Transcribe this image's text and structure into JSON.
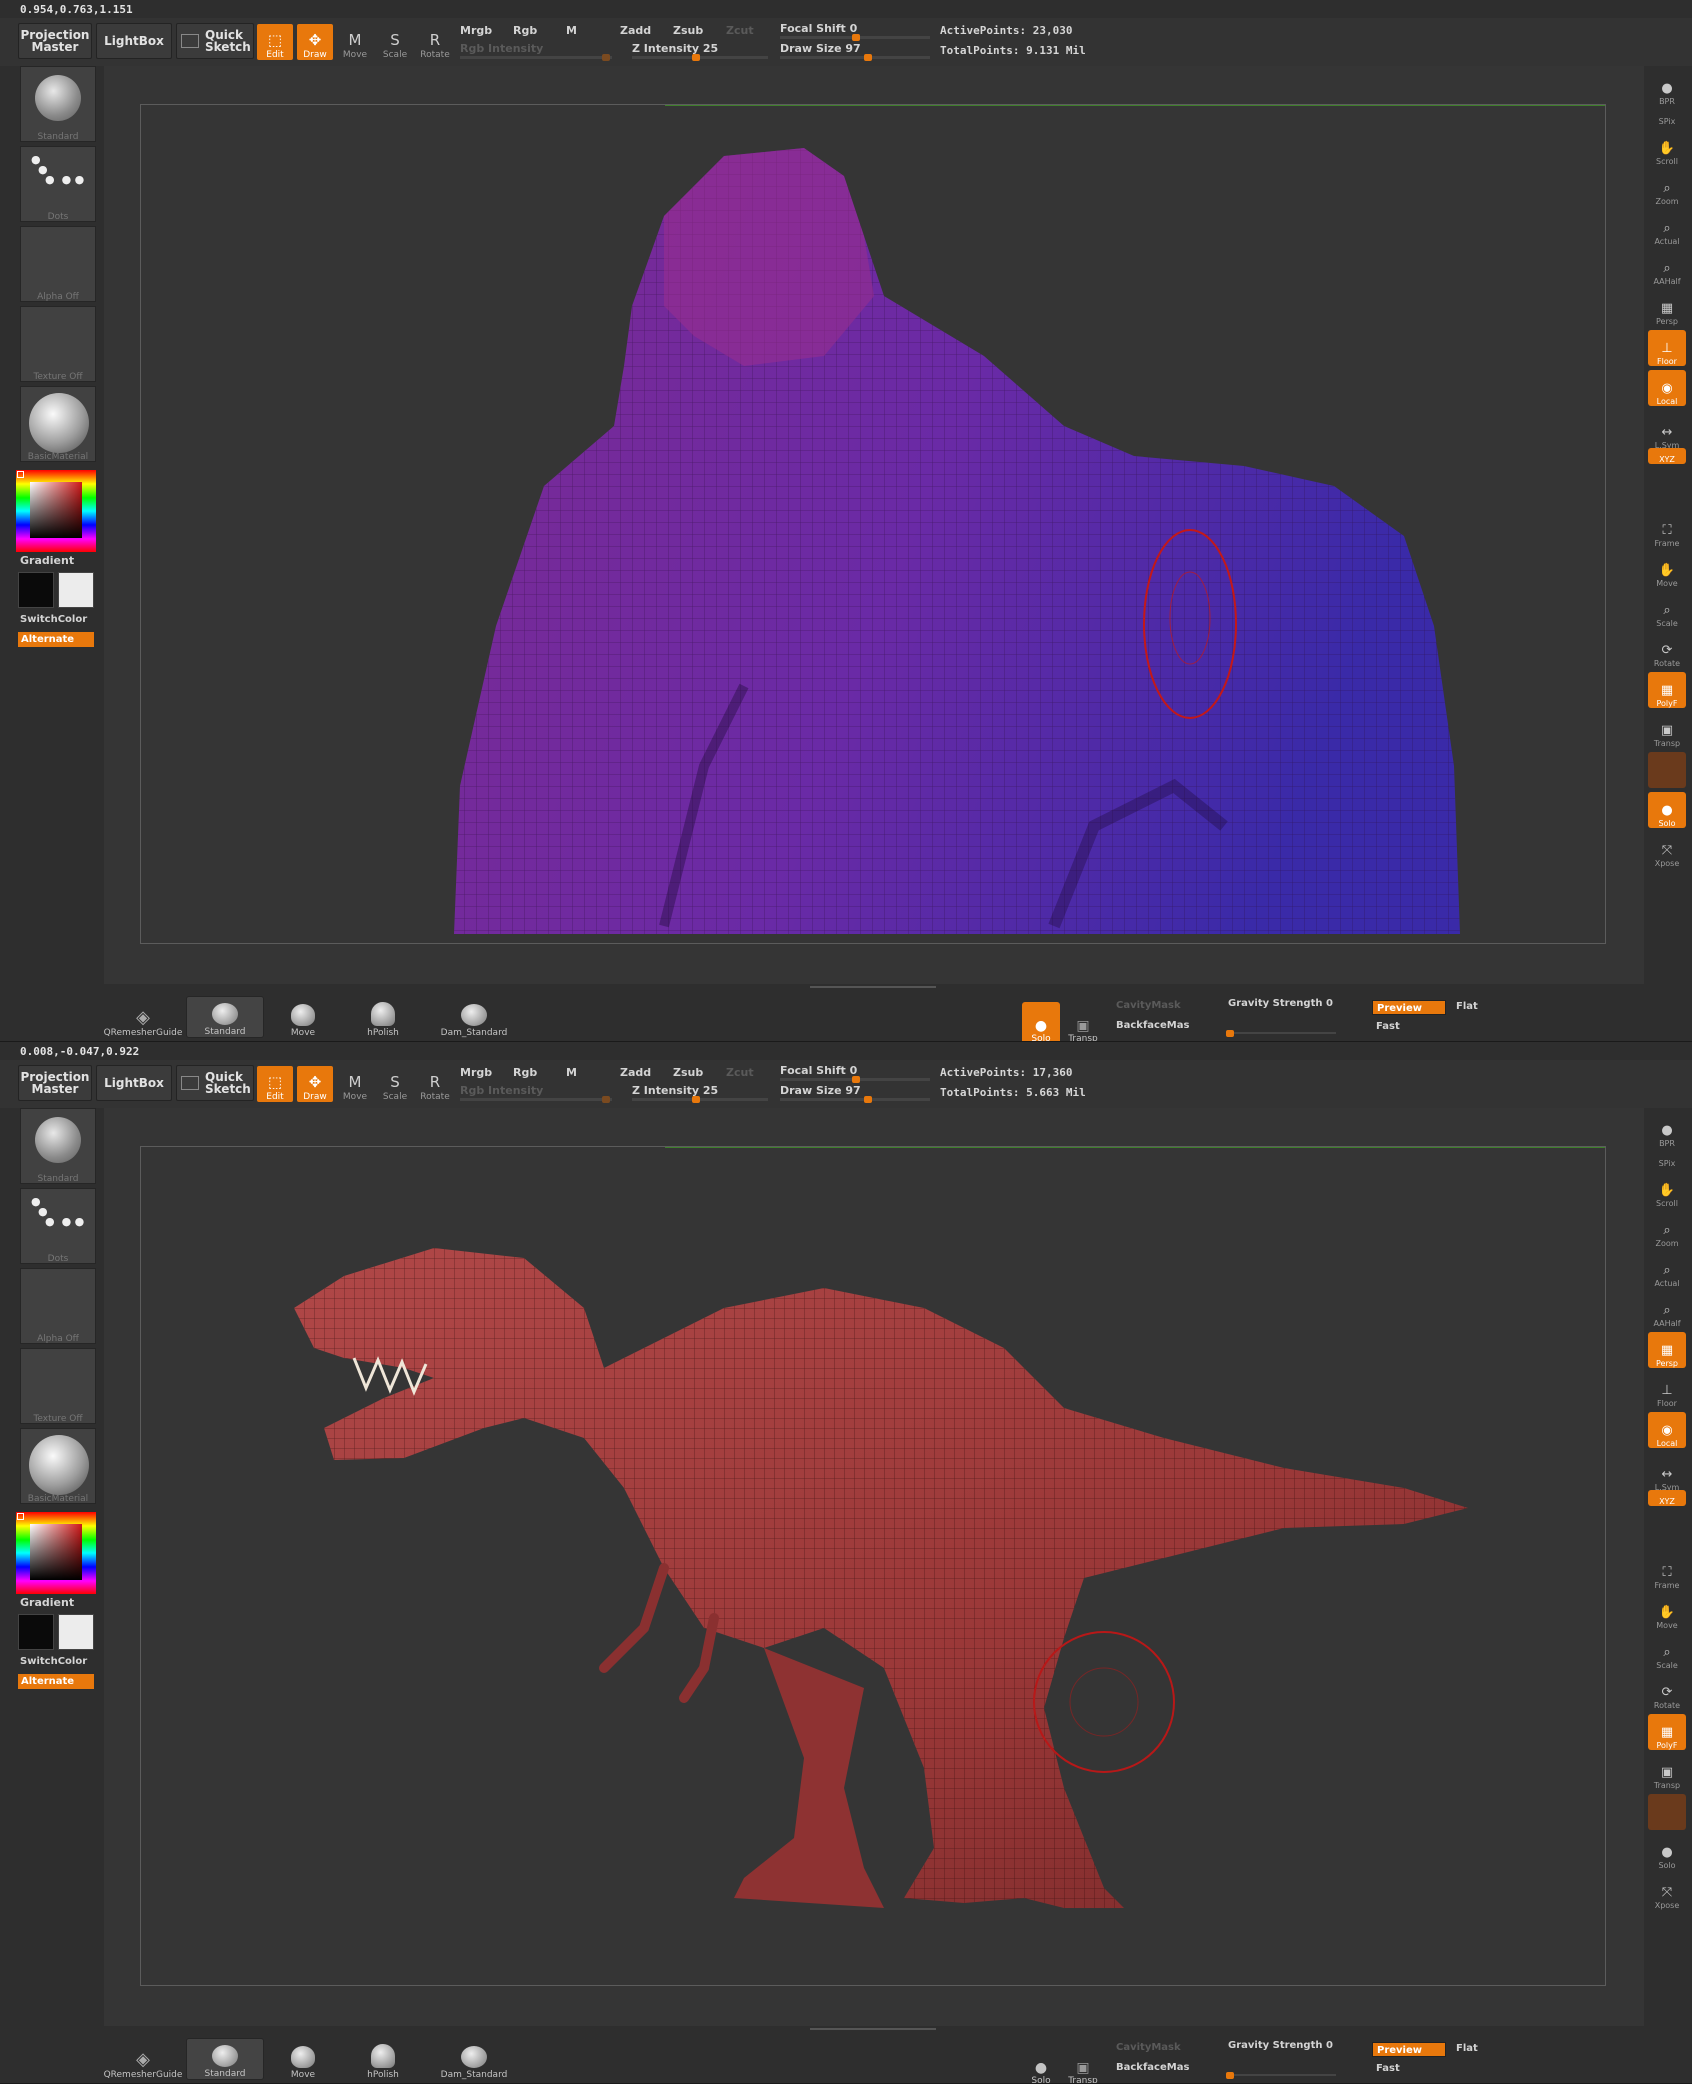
{
  "panels": [
    {
      "coord": "0.954,0.763,1.151",
      "stats": {
        "active": "ActivePoints: 23,030",
        "total": "TotalPoints: 9.131 Mil"
      },
      "solo_on": true,
      "persp_on": false,
      "floor_on": true,
      "subject": "gorilla"
    },
    {
      "coord": "0.008,-0.047,0.922",
      "stats": {
        "active": "ActivePoints: 17,360",
        "total": "TotalPoints: 5.663 Mil"
      },
      "solo_on": false,
      "persp_on": true,
      "floor_on": false,
      "subject": "t-rex"
    }
  ],
  "toolbar": {
    "projection_master_1": "Projection",
    "projection_master_2": "Master",
    "lightbox": "LightBox",
    "quick_sketch_1": "Quick",
    "quick_sketch_2": "Sketch",
    "edit": "Edit",
    "draw": "Draw",
    "move": "Move",
    "scale": "Scale",
    "rotate": "Rotate",
    "mrgb": "Mrgb",
    "rgb": "Rgb",
    "m": "M",
    "rgb_intensity": "Rgb Intensity",
    "zadd": "Zadd",
    "zsub": "Zsub",
    "zcut": "Zcut",
    "z_intensity": "Z Intensity 25",
    "focal_shift": "Focal Shift 0",
    "draw_size": "Draw Size 97"
  },
  "left_shelf": {
    "brush": "Standard",
    "stroke": "Dots",
    "alpha": "Alpha Off",
    "texture": "Texture Off",
    "material": "BasicMaterial",
    "gradient": "Gradient",
    "switch_color": "SwitchColor",
    "alternate": "Alternate"
  },
  "right_shelf": [
    "BPR",
    "SPix",
    "Scroll",
    "Zoom",
    "Actual",
    "AAHalf",
    "Persp",
    "Floor",
    "Local",
    "L.Sym",
    "XYZ",
    "Frame",
    "Move",
    "Scale",
    "Rotate",
    "PolyF",
    "Transp",
    "Solo",
    "Xpose"
  ],
  "bottom": {
    "brushes": [
      "QRemesherGuide",
      "Standard",
      "Move",
      "hPolish",
      "Dam_Standard"
    ],
    "solo": "Solo",
    "transp": "Transp",
    "cavity_mask": "CavityMask",
    "backface_mask": "BackfaceMas",
    "gravity": "Gravity Strength 0",
    "preview": "Preview",
    "flat": "Flat",
    "fast": "Fast"
  },
  "colors": {
    "accent": "#e8780c",
    "gorilla": "#7a2a9c",
    "trex": "#a63e3e"
  }
}
